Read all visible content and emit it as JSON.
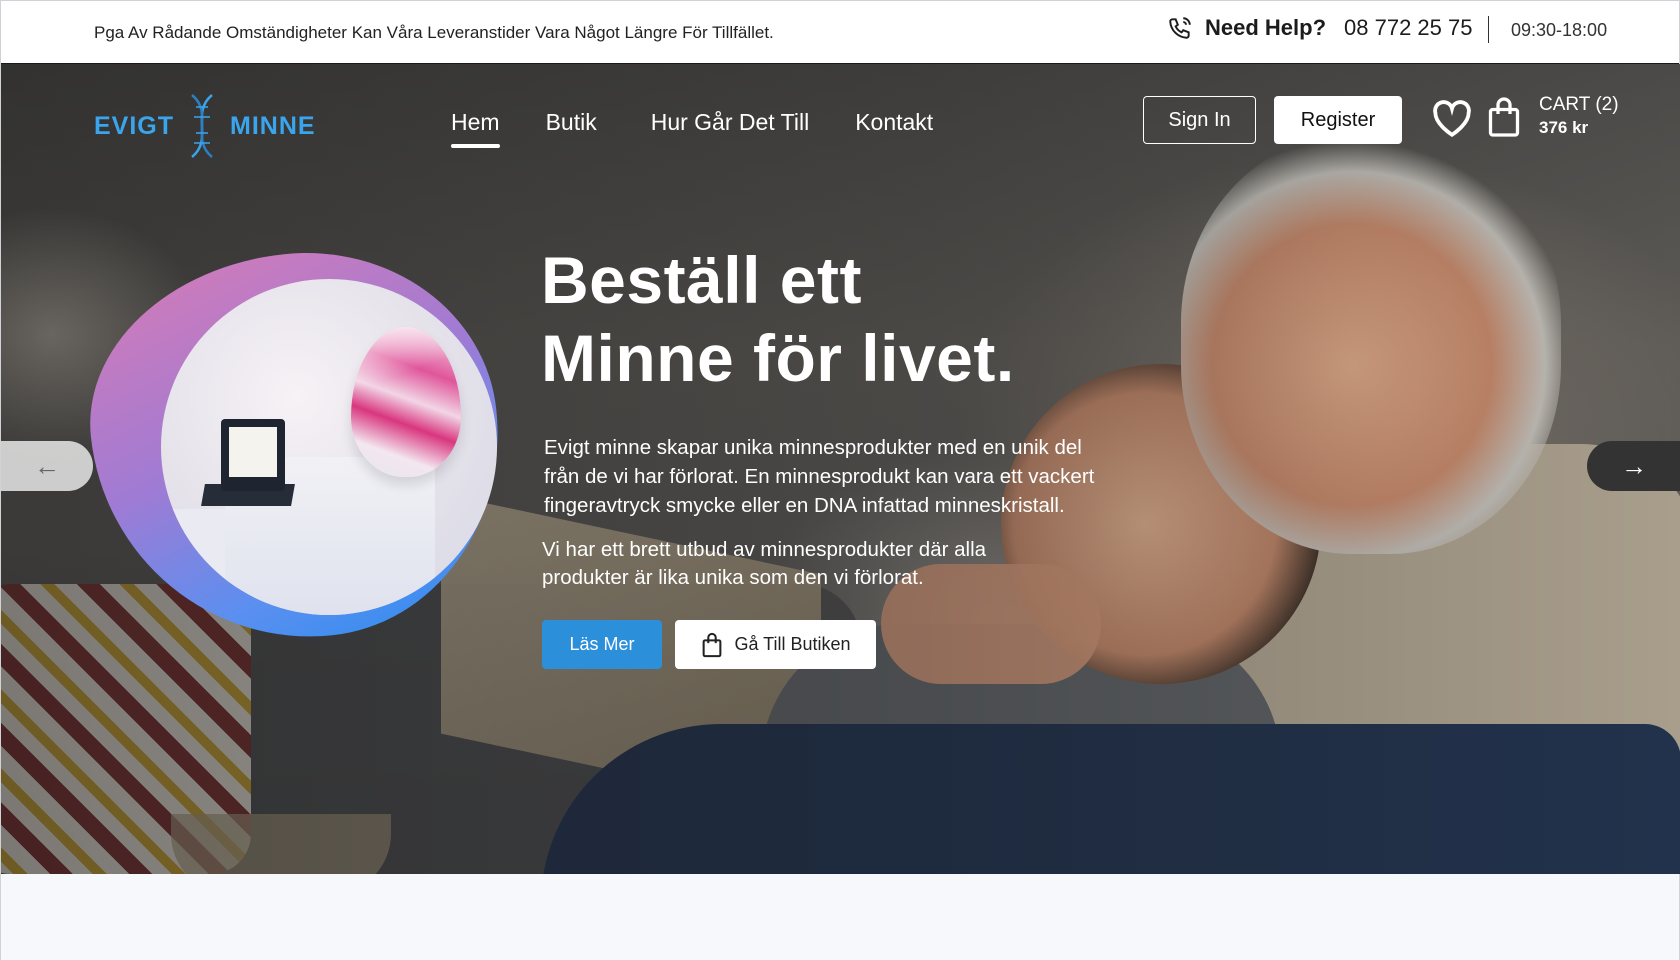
{
  "topbar": {
    "notice": "Pga Av Rådande Omständigheter Kan Våra Leveranstider Vara Något Längre För Tillfället.",
    "help_label": "Need Help?",
    "phone": "08 772 25 75",
    "hours": "09:30-18:00",
    "help_icon": "phone-call-icon"
  },
  "brand": {
    "logo_left": "EVIGT",
    "logo_right": "MINNE",
    "logo_icon": "dna-helix-icon",
    "color": "#3aa4ec"
  },
  "nav": {
    "items": [
      {
        "label": "Hem",
        "active": true
      },
      {
        "label": "Butik",
        "active": false
      },
      {
        "label": "Hur Går Det Till",
        "active": false
      },
      {
        "label": "Kontakt",
        "active": false
      }
    ]
  },
  "account": {
    "signin_label": "Sign In",
    "register_label": "Register",
    "wishlist_icon": "heart-icon",
    "cart_icon": "shopping-bag-icon",
    "cart_label": "CART (2)",
    "cart_amount": "376 kr"
  },
  "hero": {
    "headline_line1": "Beställ ett",
    "headline_line2": "Minne för livet.",
    "paragraph1": "Evigt minne skapar unika minnesprodukter med en unik del från de vi har förlorat. En minnesprodukt kan vara ett vackert fingeravtryck smycke eller en DNA infattad minneskristall.",
    "paragraph2": "Vi har ett brett utbud av minnesprodukter där alla produkter är lika unika som den vi förlorat.",
    "cta_primary": "Läs Mer",
    "cta_secondary": "Gå Till Butiken",
    "cta_secondary_icon": "shopping-bag-icon",
    "accent_color": "#2b8fd9",
    "prev_icon": "arrow-left-icon",
    "next_icon": "arrow-right-icon"
  }
}
